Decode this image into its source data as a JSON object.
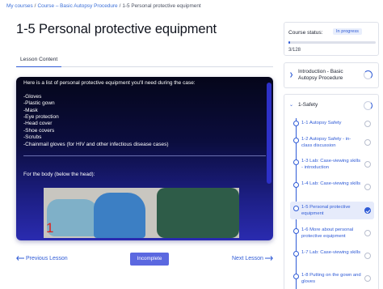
{
  "breadcrumb": {
    "items": [
      "My courses",
      "Course – Basic Autopsy Procedure",
      "1-5 Personal protective equipment"
    ],
    "separator": "/"
  },
  "page": {
    "title": "1-5 Personal protective equipment"
  },
  "tabs": [
    {
      "label": "Lesson Content",
      "active": true
    }
  ],
  "video": {
    "intro": "Here is a list of personal protective equipment you'll need during the case:",
    "items": [
      "-Gloves",
      "-Plastic gown",
      "-Mask",
      "-Eye protection",
      "-Head cover",
      "-Shoe covers",
      "-Scrubs",
      "-Chainmail gloves (for HIV and other infectious disease cases)"
    ],
    "body_heading": "For the body (below the head):",
    "photo_label": "1"
  },
  "nav": {
    "prev_label": "Previous Lesson",
    "next_label": "Next Lesson",
    "status_button": "Incomplete"
  },
  "course_status": {
    "label": "Course status:",
    "badge": "In progress",
    "count": "3/128",
    "progress_fraction": 0.023
  },
  "sections": [
    {
      "name": "Introduction - Basic Autopsy Procedure",
      "expanded": false
    },
    {
      "name": "1-Safety",
      "expanded": true,
      "lessons": [
        {
          "label": "1-1 Autopsy Safety",
          "active": false,
          "complete": false
        },
        {
          "label": "1-2 Autopsy Safety - in-class discussion",
          "active": false,
          "complete": false
        },
        {
          "label": "1-3 Lab: Case-viewing skills - introduction",
          "active": false,
          "complete": false
        },
        {
          "label": "1-4 Lab: Case-viewing skills",
          "active": false,
          "complete": false
        },
        {
          "label": "1-5 Personal protective equipment",
          "active": true,
          "complete": true
        },
        {
          "label": "1-6 More about personal protective equipment",
          "active": false,
          "complete": false
        },
        {
          "label": "1-7 Lab: Case-viewing skills",
          "active": false,
          "complete": false
        },
        {
          "label": "1-8 Putting on the gown and gloves",
          "active": false,
          "complete": false
        }
      ]
    }
  ],
  "colors": {
    "accent": "#2f5bd6",
    "button": "#5b68e0",
    "video_bg": "#0b0d3e"
  }
}
